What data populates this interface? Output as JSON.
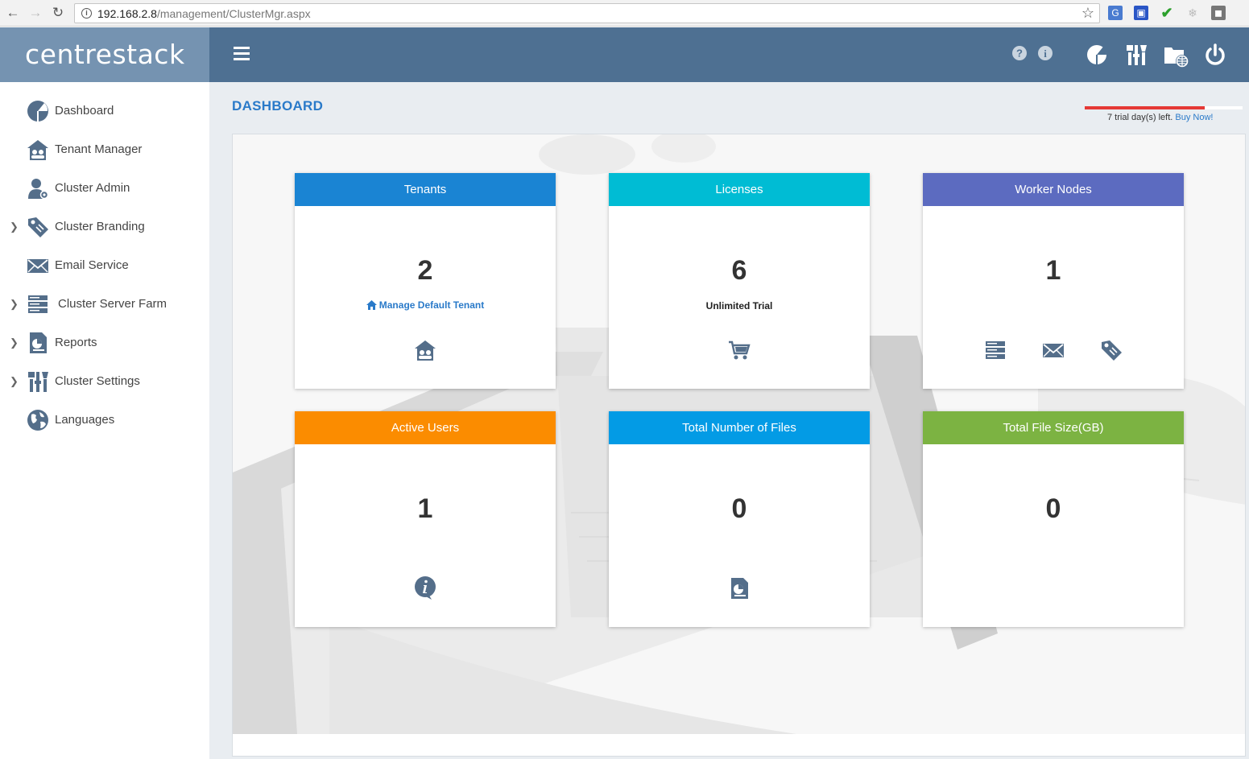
{
  "browser": {
    "url_host": "192.168.2.8",
    "url_path": "/management/ClusterMgr.aspx"
  },
  "app": {
    "logo": "centrestack",
    "page_title": "DASHBOARD"
  },
  "trial": {
    "message": "7 trial day(s) left.",
    "buy_label": "Buy Now!",
    "progress_fraction": 0.76,
    "bar_color": "#e53935"
  },
  "header_icons": [
    "help-icon",
    "info-icon",
    "dashboard-pie-icon",
    "settings-tools-icon",
    "folder-globe-icon",
    "power-icon"
  ],
  "sidebar": {
    "items": [
      {
        "label": "Dashboard",
        "icon": "dashboard-pie-icon",
        "expandable": false
      },
      {
        "label": "Tenant Manager",
        "icon": "tenant-house-icon",
        "expandable": false
      },
      {
        "label": "Cluster Admin",
        "icon": "user-gear-icon",
        "expandable": false
      },
      {
        "label": "Cluster Branding",
        "icon": "tag-icon",
        "expandable": true
      },
      {
        "label": "Email Service",
        "icon": "envelope-icon",
        "expandable": false
      },
      {
        "label": "Cluster Server Farm",
        "icon": "server-icon",
        "expandable": true
      },
      {
        "label": "Reports",
        "icon": "report-icon",
        "expandable": true
      },
      {
        "label": "Cluster Settings",
        "icon": "tools-icon",
        "expandable": true
      },
      {
        "label": "Languages",
        "icon": "globe-icon",
        "expandable": false
      }
    ]
  },
  "cards": [
    {
      "title": "Tenants",
      "value": "2",
      "link": "Manage Default Tenant",
      "color": "#1a84d3",
      "icons": [
        "tenant-house-icon"
      ]
    },
    {
      "title": "Licenses",
      "value": "6",
      "subtitle": "Unlimited Trial",
      "color": "#00bcd4",
      "icons": [
        "cart-icon"
      ]
    },
    {
      "title": "Worker Nodes",
      "value": "1",
      "color": "#5c6bc0",
      "icons": [
        "server-icon",
        "envelope-icon",
        "tag-icon"
      ]
    },
    {
      "title": "Active Users",
      "value": "1",
      "color": "#fb8c00",
      "icons": [
        "info-bubble-icon"
      ]
    },
    {
      "title": "Total Number of Files",
      "value": "0",
      "color": "#039be5",
      "icons": [
        "report-icon"
      ]
    },
    {
      "title": "Total File Size(GB)",
      "value": "0",
      "color": "#7cb342",
      "icons": []
    }
  ]
}
